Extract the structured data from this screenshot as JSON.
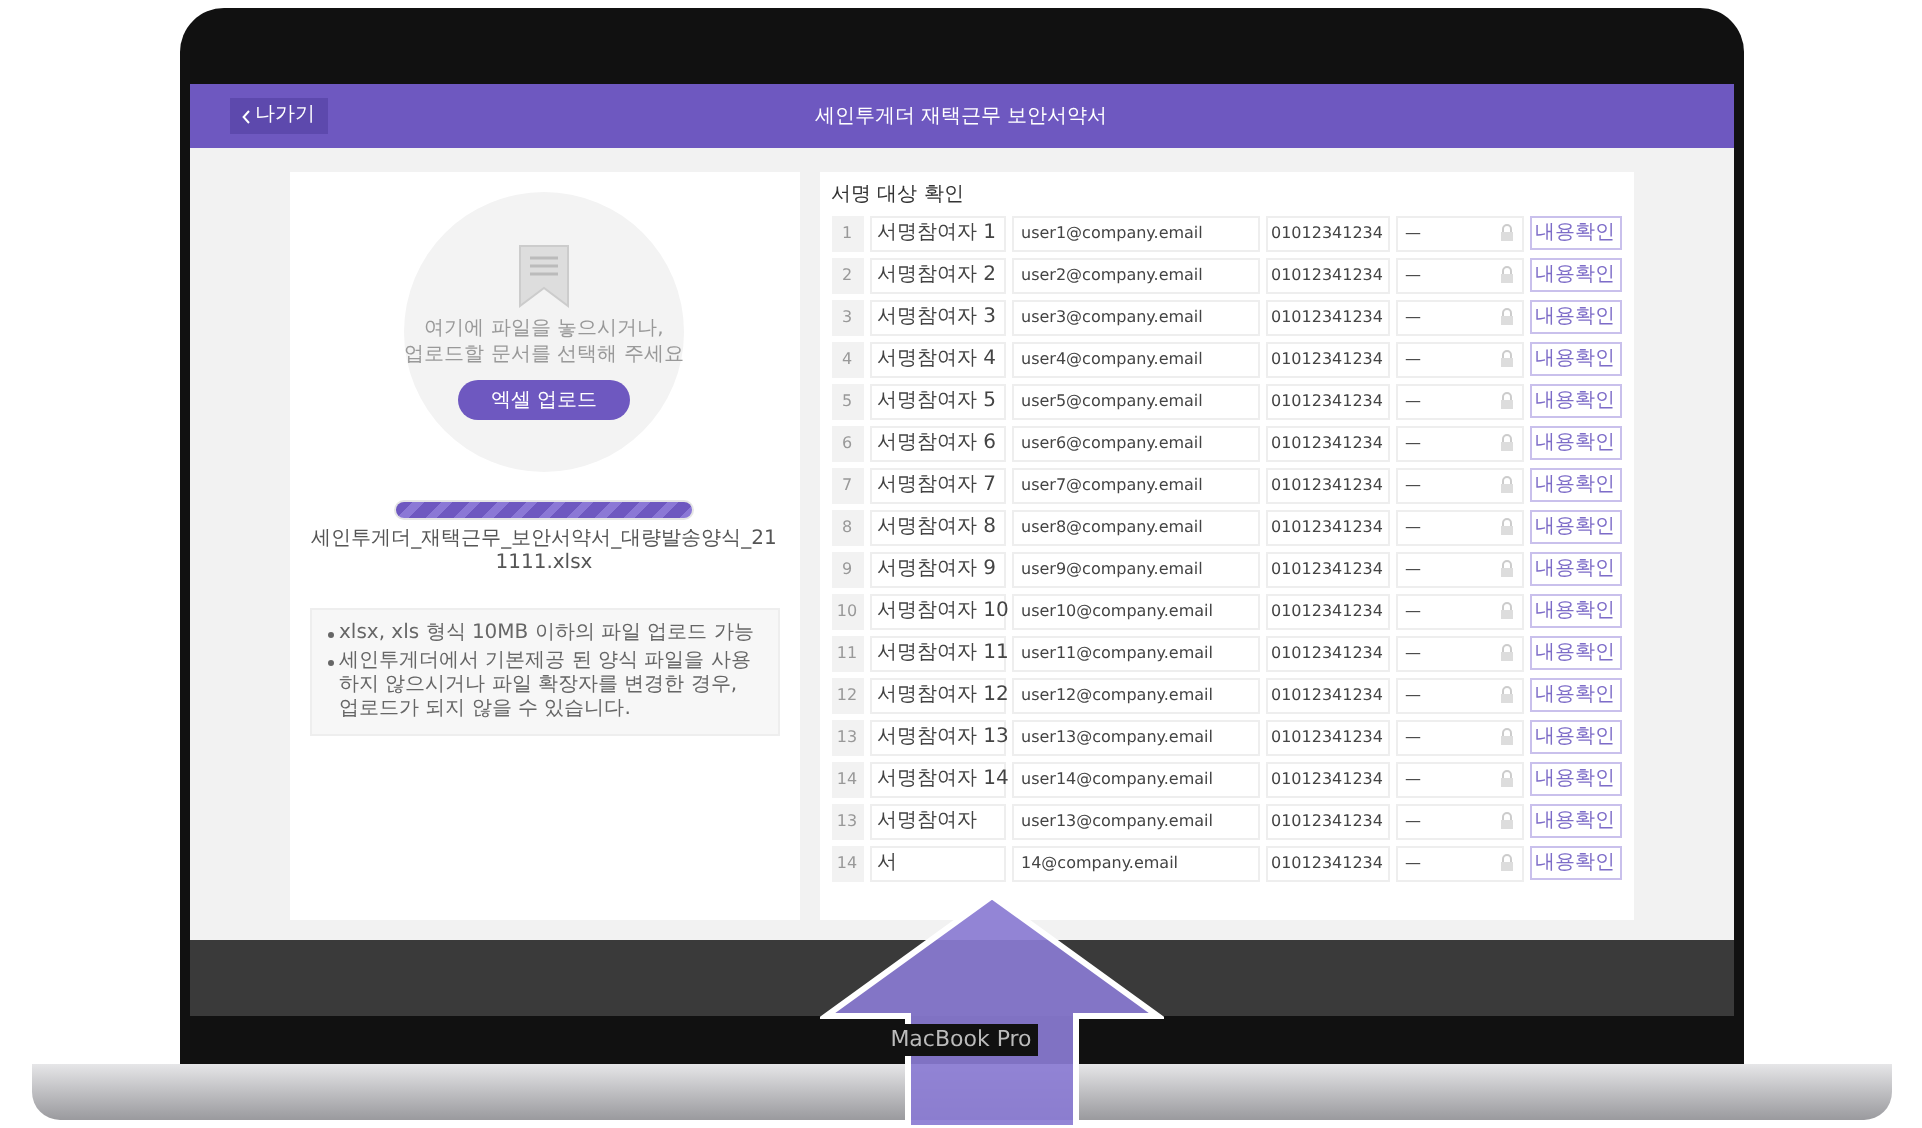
{
  "header": {
    "back_button": "나가기",
    "title": "세인투게더 재택근무 보안서약서"
  },
  "upload": {
    "prompt": "여기에 파일을 놓으시거나,\n업로드할 문서를 선택해 주세요",
    "button": "엑셀 업로드",
    "progress": {
      "level": 1
    },
    "file_name": "세인투게더_재택근무_보안서약서_대량발송양식_211111.xlsx"
  },
  "notes": [
    "xlsx, xls 형식 10MB 이하의 파일 업로드 가능",
    "세인투게더에서 기본제공 된 양식 파일을 사용하지 않으시거나 파일 확장자를 변경한 경우, 업로드가 되지 않을 수 있습니다."
  ],
  "signers": {
    "title": "서명 대상 확인",
    "rows": [
      {
        "no": "1",
        "name": "서명참여자 1",
        "email": "user1@company.email",
        "phone": "01012341234",
        "password": "—",
        "button": "내용확인"
      },
      {
        "no": "2",
        "name": "서명참여자 2",
        "email": "user2@company.email",
        "phone": "01012341234",
        "password": "—",
        "button": "내용확인"
      },
      {
        "no": "3",
        "name": "서명참여자 3",
        "email": "user3@company.email",
        "phone": "01012341234",
        "password": "—",
        "button": "내용확인"
      },
      {
        "no": "4",
        "name": "서명참여자 4",
        "email": "user4@company.email",
        "phone": "01012341234",
        "password": "—",
        "button": "내용확인"
      },
      {
        "no": "5",
        "name": "서명참여자 5",
        "email": "user5@company.email",
        "phone": "01012341234",
        "password": "—",
        "button": "내용확인"
      },
      {
        "no": "6",
        "name": "서명참여자 6",
        "email": "user6@company.email",
        "phone": "01012341234",
        "password": "—",
        "button": "내용확인"
      },
      {
        "no": "7",
        "name": "서명참여자 7",
        "email": "user7@company.email",
        "phone": "01012341234",
        "password": "—",
        "button": "내용확인"
      },
      {
        "no": "8",
        "name": "서명참여자 8",
        "email": "user8@company.email",
        "phone": "01012341234",
        "password": "—",
        "button": "내용확인"
      },
      {
        "no": "9",
        "name": "서명참여자 9",
        "email": "user9@company.email",
        "phone": "01012341234",
        "password": "—",
        "button": "내용확인"
      },
      {
        "no": "10",
        "name": "서명참여자 10",
        "email": "user10@company.email",
        "phone": "01012341234",
        "password": "—",
        "button": "내용확인"
      },
      {
        "no": "11",
        "name": "서명참여자 11",
        "email": "user11@company.email",
        "phone": "01012341234",
        "password": "—",
        "button": "내용확인"
      },
      {
        "no": "12",
        "name": "서명참여자 12",
        "email": "user12@company.email",
        "phone": "01012341234",
        "password": "—",
        "button": "내용확인"
      },
      {
        "no": "13",
        "name": "서명참여자 13",
        "email": "user13@company.email",
        "phone": "01012341234",
        "password": "—",
        "button": "내용확인"
      },
      {
        "no": "14",
        "name": "서명참여자 14",
        "email": "user14@company.email",
        "phone": "01012341234",
        "password": "—",
        "button": "내용확인"
      },
      {
        "no": "13",
        "name": "서명참여자",
        "email": "user13@company.email",
        "phone": "01012341234",
        "password": "—",
        "button": "내용확인"
      },
      {
        "no": "14",
        "name": "서",
        "email": "14@company.email",
        "phone": "01012341234",
        "password": "—",
        "button": "내용확인"
      }
    ]
  },
  "device": {
    "label": "MacBook Pro"
  }
}
